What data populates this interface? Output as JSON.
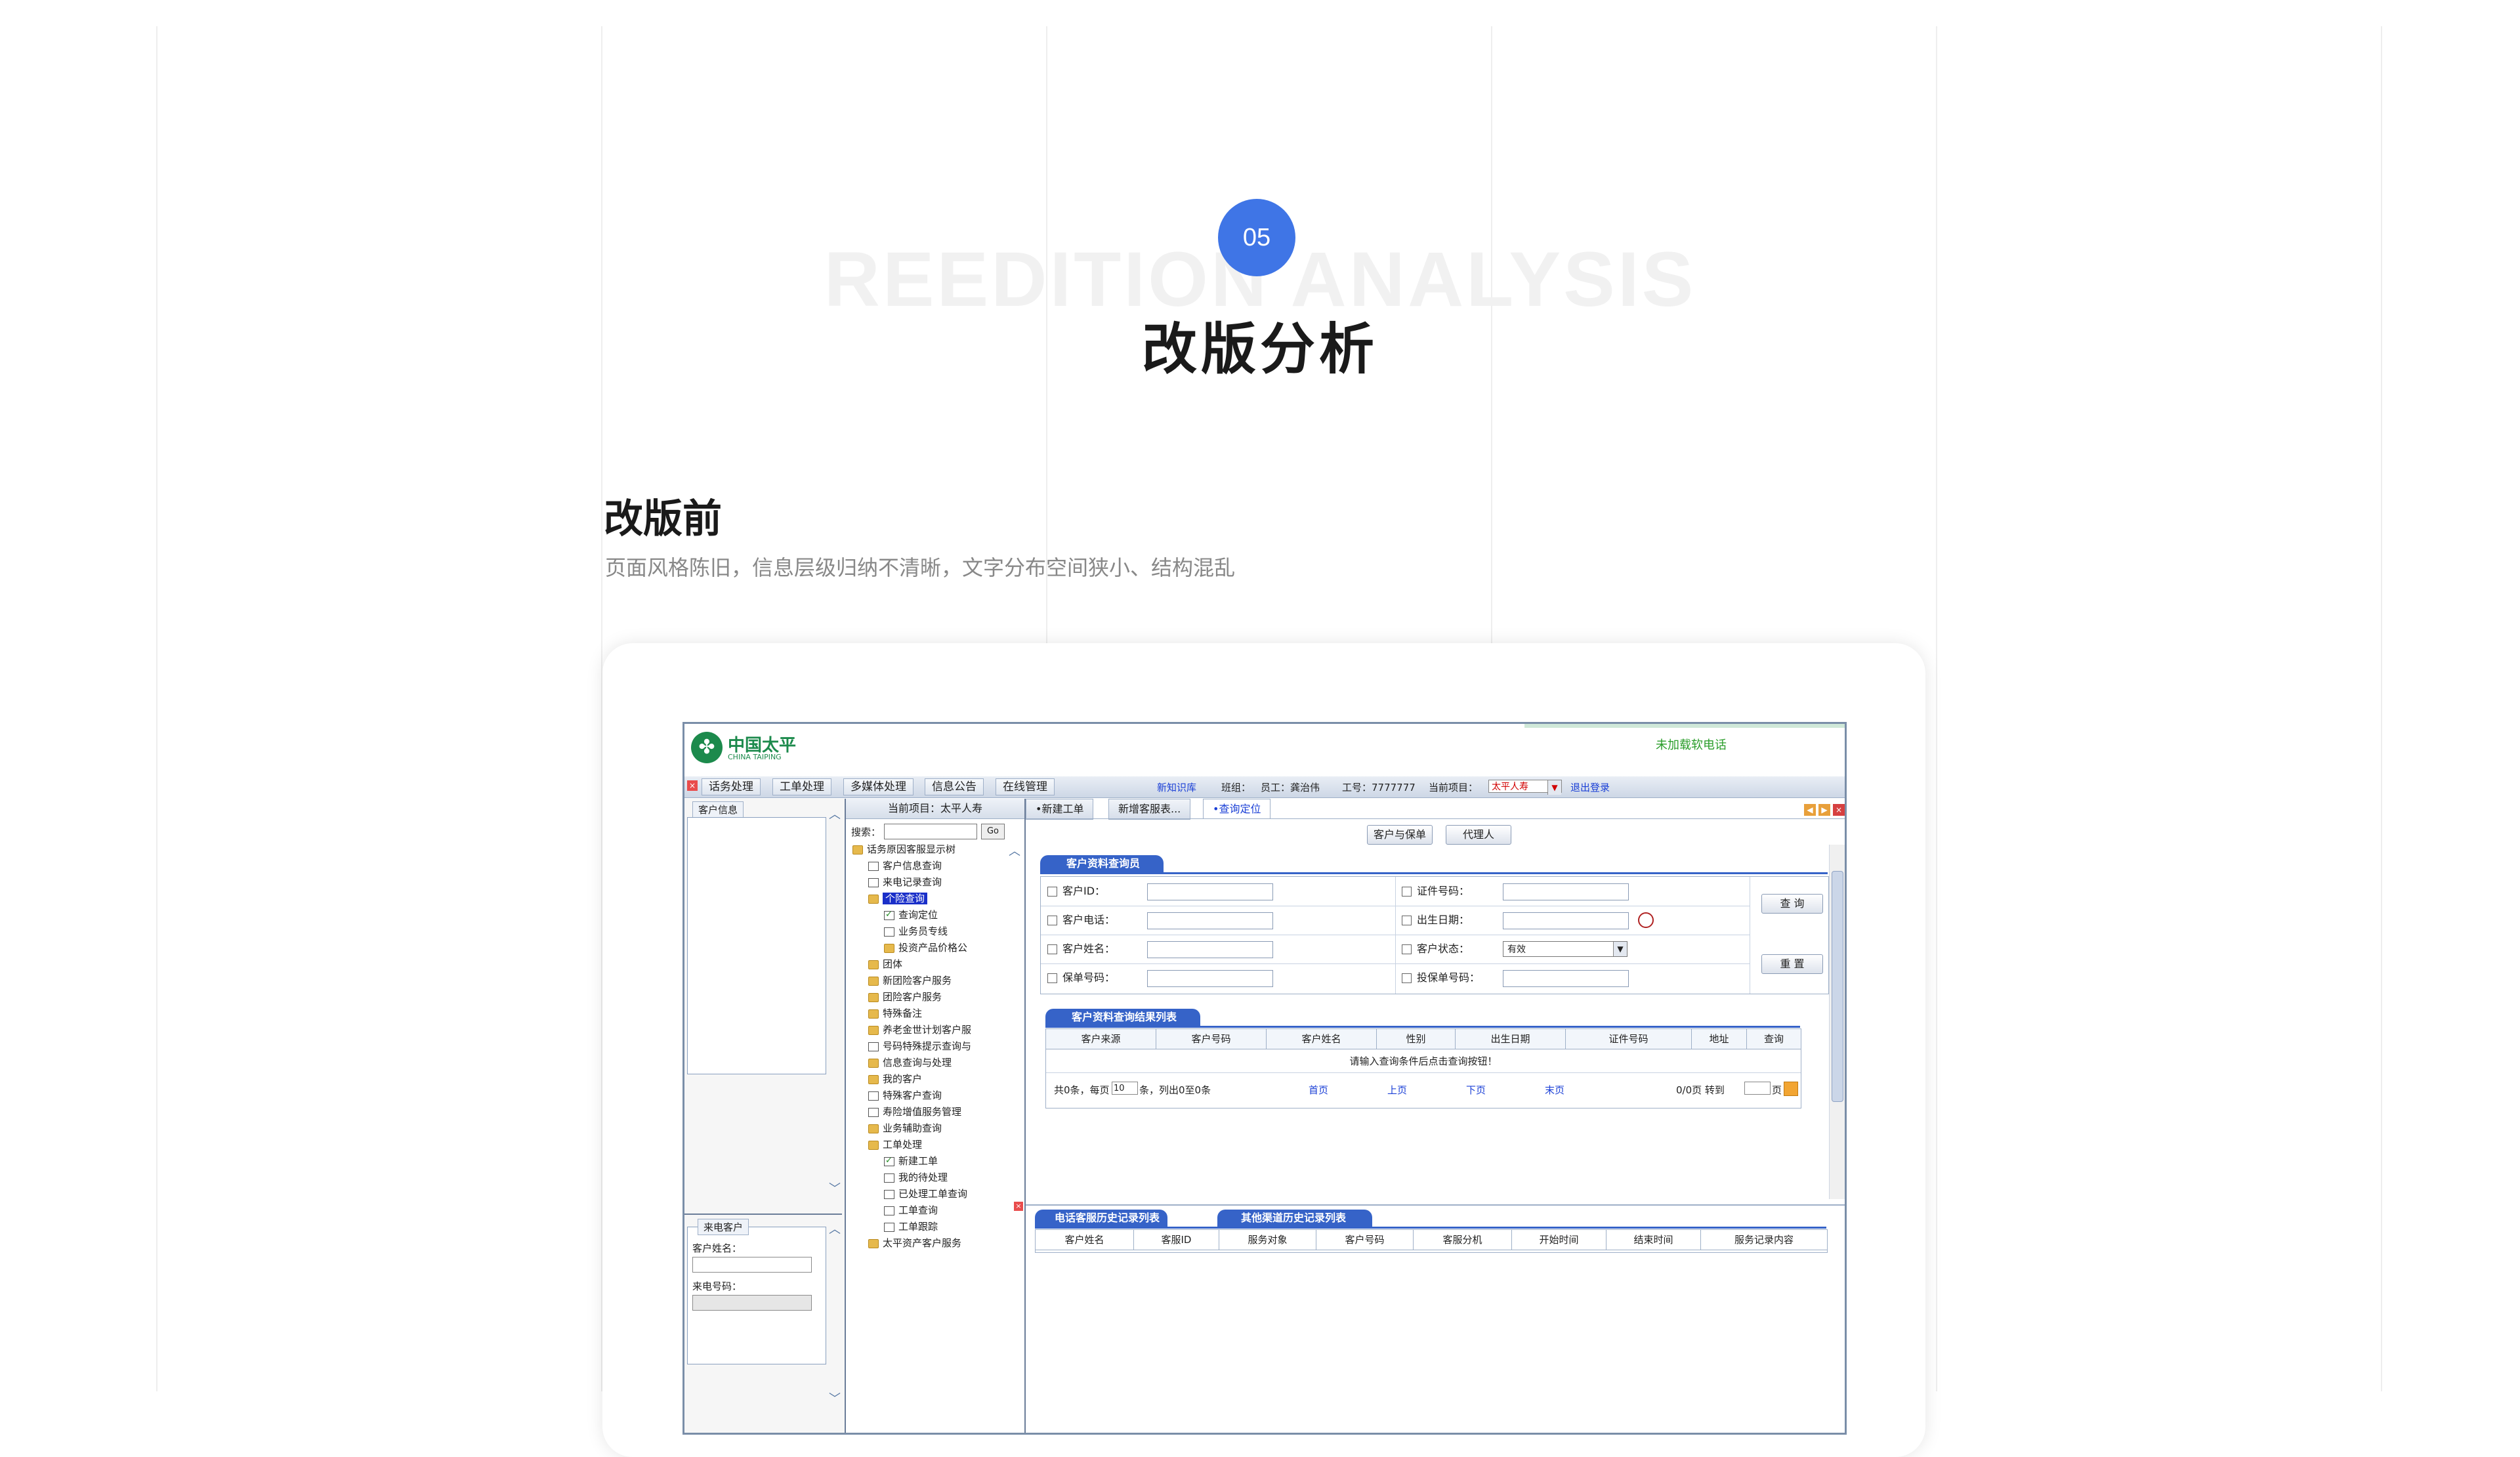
{
  "page": {
    "step_number": "05",
    "bg_title": "REEDITION ANALYSIS",
    "title": "改版分析",
    "section_title": "改版前",
    "section_desc": "页面风格陈旧，信息层级归纳不清晰，文字分布空间狭小、结构混乱"
  },
  "legacy_app": {
    "logo_cn": "中国太平",
    "logo_en": "CHINA TAIPING",
    "unload_text": "未加载软电话",
    "menus": [
      "话务处理",
      "工单处理",
      "多媒体处理",
      "信息公告",
      "在线管理"
    ],
    "info": {
      "new_note": "新知识库",
      "group": "班组：",
      "employee": "员工：龚治伟",
      "job_no": "工号：7777777",
      "current_project_label": "当前项目：",
      "project_value": "太平人寿",
      "logout": "退出登录"
    },
    "left": {
      "customer_info_tab": "客户信息",
      "caller_tab": "来电客户",
      "caller_name_label": "客户姓名：",
      "caller_phone_label": "来电号码："
    },
    "tree": {
      "header": "当前项目：太平人寿",
      "search_label": "搜索：",
      "go": "Go",
      "items": [
        {
          "label": "话务原因客服显示树",
          "icon": "folder",
          "indent": 0
        },
        {
          "label": "客户信息查询",
          "icon": "page",
          "indent": 1
        },
        {
          "label": "来电记录查询",
          "icon": "page",
          "indent": 1
        },
        {
          "label": "个险查询",
          "icon": "folder",
          "indent": 1,
          "selected": true
        },
        {
          "label": "查询定位",
          "icon": "check",
          "indent": 2
        },
        {
          "label": "业务员专线",
          "icon": "page",
          "indent": 2
        },
        {
          "label": "投资产品价格公",
          "icon": "folder",
          "indent": 2
        },
        {
          "label": "团体",
          "icon": "folder",
          "indent": 1
        },
        {
          "label": "新团险客户服务",
          "icon": "folder",
          "indent": 1
        },
        {
          "label": "团险客户服务",
          "icon": "folder",
          "indent": 1
        },
        {
          "label": "特殊备注",
          "icon": "folder",
          "indent": 1
        },
        {
          "label": "养老金世计划客户服",
          "icon": "folder",
          "indent": 1
        },
        {
          "label": "号码特殊提示查询与",
          "icon": "page",
          "indent": 1
        },
        {
          "label": "信息查询与处理",
          "icon": "folder",
          "indent": 1
        },
        {
          "label": "我的客户",
          "icon": "folder",
          "indent": 1
        },
        {
          "label": "特殊客户查询",
          "icon": "page",
          "indent": 1
        },
        {
          "label": "寿险增值服务管理",
          "icon": "page",
          "indent": 1
        },
        {
          "label": "业务辅助查询",
          "icon": "folder",
          "indent": 1
        },
        {
          "label": "工单处理",
          "icon": "folder",
          "indent": 1
        },
        {
          "label": "新建工单",
          "icon": "check",
          "indent": 2
        },
        {
          "label": "我的待处理",
          "icon": "page",
          "indent": 2
        },
        {
          "label": "已处理工单查询",
          "icon": "page",
          "indent": 2
        },
        {
          "label": "工单查询",
          "icon": "page",
          "indent": 2
        },
        {
          "label": "工单跟踪",
          "icon": "page",
          "indent": 2
        },
        {
          "label": "太平资产客户服务",
          "icon": "folder",
          "indent": 1
        }
      ]
    },
    "tabs": [
      "•新建工单",
      "新增客服表...",
      "•查询定位"
    ],
    "top_buttons": [
      "客户与保单",
      "代理人"
    ],
    "query_panel": {
      "title": "客户资料查询员",
      "left_fields": [
        "客户ID：",
        "客户电话：",
        "客户姓名：",
        "保单号码："
      ],
      "right_fields": [
        "证件号码：",
        "出生日期：",
        "客户状态：",
        "投保单号码："
      ],
      "status_value": "有效",
      "query_button": "查 询",
      "reset_button": "重 置"
    },
    "result_panel": {
      "title": "客户资料查询结果列表",
      "columns": [
        "客户来源",
        "客户号码",
        "客户姓名",
        "性别",
        "出生日期",
        "证件号码",
        "地址",
        "查询"
      ],
      "empty_message": "请输入查询条件后点击查询按钮！",
      "pager": {
        "summary_prefix": "共0条，每页",
        "page_size": "10",
        "summary_suffix": "条，列出0至0条",
        "first": "首页",
        "prev": "上页",
        "next": "下页",
        "last": "末页",
        "pages": "0/0页  转到",
        "page_unit": "页"
      }
    },
    "history": {
      "tab1": "电话客服历史记录列表",
      "tab2": "其他渠道历史记录列表",
      "columns": [
        "客户姓名",
        "客服ID",
        "服务对象",
        "客户号码",
        "客服分机",
        "开始时间",
        "结束时间",
        "服务记录内容"
      ]
    }
  }
}
